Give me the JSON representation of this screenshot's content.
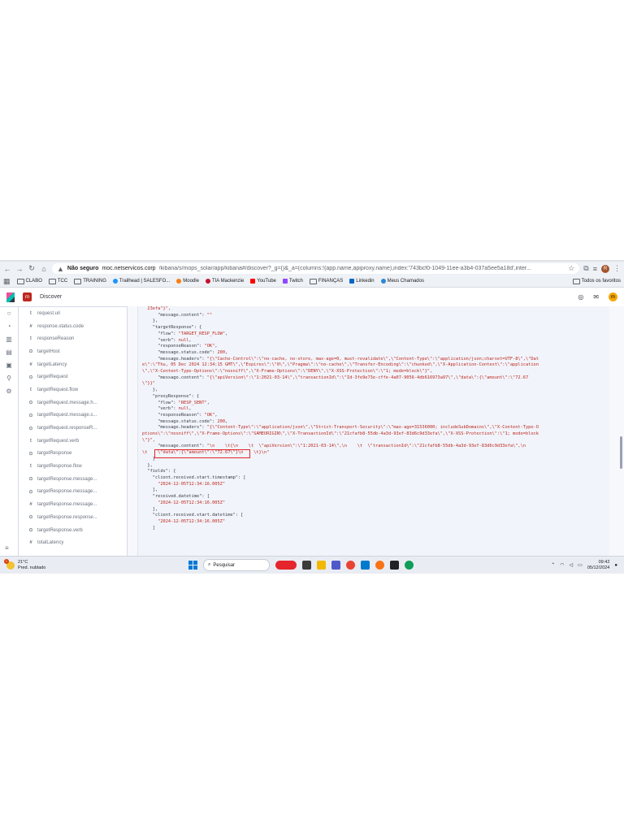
{
  "browser": {
    "security_label": "Não seguro",
    "url_domain": "moc.netservicos.corp",
    "url_path": "/kibana/s/mops_solar/app/kibana#/discover?_g=()&_a=(columns:!(app.name,apiproxy.name),index:'743bcf0-1049-11ee-a3b4-037a5ee5a18d',inter...",
    "profile_initial": "R",
    "bookmarks": [
      "CLABO",
      "TCC",
      "TRAINING",
      "Trailhead | SALESFO...",
      "Moodle",
      "TIA Mackenzie",
      "YouTube",
      "Twitch",
      "FINANÇAS",
      "Linkedin",
      "Meus Chamados"
    ],
    "all_bookmarks": "Todos os favoritos",
    "accent": "#1a73e8"
  },
  "kibana": {
    "space_initial": "m",
    "page_title": "Discover",
    "user_initial": "m"
  },
  "fields": [
    {
      "type": "t",
      "name": "request.uri"
    },
    {
      "type": "#",
      "name": "response.status.code"
    },
    {
      "type": "t",
      "name": "responseReason"
    },
    {
      "type": "⊙",
      "name": "targetHost"
    },
    {
      "type": "#",
      "name": "targetLatency"
    },
    {
      "type": "⊙",
      "name": "targetRequest"
    },
    {
      "type": "t",
      "name": "targetRequest.flow"
    },
    {
      "type": "⊙",
      "name": "targetRequest.message.h..."
    },
    {
      "type": "⊙",
      "name": "targetRequest.message.s..."
    },
    {
      "type": "⊙",
      "name": "targetRequest.responseR..."
    },
    {
      "type": "t",
      "name": "targetRequest.verb"
    },
    {
      "type": "⊙",
      "name": "targetResponse"
    },
    {
      "type": "t",
      "name": "targetResponse.flow"
    },
    {
      "type": "⊙",
      "name": "targetResponse.message..."
    },
    {
      "type": "⊙",
      "name": "targetResponse.message..."
    },
    {
      "type": "#",
      "name": "targetResponse.message..."
    },
    {
      "type": "⊙",
      "name": "targetResponse.response..."
    },
    {
      "type": "⊙",
      "name": "targetResponse.verb"
    },
    {
      "type": "#",
      "name": "totalLatency"
    }
  ],
  "json_lines": [
    [
      {
        "c": "s",
        "t": "  23efa\"}\","
      }
    ],
    [
      {
        "c": "k",
        "t": "      \"message.content\": "
      },
      {
        "c": "s",
        "t": "\"\""
      }
    ],
    [
      {
        "c": "k",
        "t": "    },"
      }
    ],
    [
      {
        "c": "k",
        "t": "    \"targetResponse\": {"
      }
    ],
    [
      {
        "c": "k",
        "t": "      \"flow\": "
      },
      {
        "c": "s",
        "t": "\"TARGET_RESP_FLOW\""
      },
      {
        "c": "k",
        "t": ","
      }
    ],
    [
      {
        "c": "k",
        "t": "      \"verb\": "
      },
      {
        "c": "s",
        "t": "null"
      },
      {
        "c": "k",
        "t": ","
      }
    ],
    [
      {
        "c": "k",
        "t": "      \"responseReason\": "
      },
      {
        "c": "s",
        "t": "\"OK\""
      },
      {
        "c": "k",
        "t": ","
      }
    ],
    [
      {
        "c": "k",
        "t": "      \"message.status.code\": "
      },
      {
        "c": "s",
        "t": "200"
      },
      {
        "c": "k",
        "t": ","
      }
    ],
    [
      {
        "c": "k",
        "t": "      \"message.headers\": "
      },
      {
        "c": "s",
        "t": "\"{\\\"Cache-Control\\\":\\\"no-cache, no-store, max-age=0, must-revalidate\\\",\\\"Content-Type\\\":\\\"application/json;charset=UTF-8\\\",\\\"Dat"
      }
    ],
    [
      {
        "c": "s",
        "t": "e\\\":\\\"Thu, 05 Dec 2024 12:34:15 GMT\\\",\\\"Expires\\\":\\\"0\\\",\\\"Pragma\\\":\\\"no-cache\\\",\\\"Transfer-Encoding\\\":\\\"chunked\\\",\\\"X-Application-Context\\\":\\\"application"
      }
    ],
    [
      {
        "c": "s",
        "t": "\\\",\\\"X-Content-Type-Options\\\":\\\"nosniff\\\",\\\"X-Frame-Options\\\":\\\"DENY\\\",\\\"X-XSS-Protection\\\":\\\"1; mode=block\\\"}\","
      }
    ],
    [
      {
        "c": "k",
        "t": "      \"message.content\": "
      },
      {
        "c": "s",
        "t": "\"{\\\"apiVersion\\\":\\\"1:2021-03-14\\\",\\\"transactionId\\\":\\\"Id-3fe9e73e-cffe-4a07-9056-4db616973a97\\\",\\\"data\\\":{\\\"amount\\\":\\\"72.67"
      }
    ],
    [
      {
        "c": "s",
        "t": "\\\"}}\""
      }
    ],
    [
      {
        "c": "k",
        "t": "    },"
      }
    ],
    [
      {
        "c": "k",
        "t": "    \"proxyResponse\": {"
      }
    ],
    [
      {
        "c": "k",
        "t": "      \"flow\": "
      },
      {
        "c": "s",
        "t": "\"RESP_SENT\""
      },
      {
        "c": "k",
        "t": ","
      }
    ],
    [
      {
        "c": "k",
        "t": "      \"verb\": "
      },
      {
        "c": "s",
        "t": "null"
      },
      {
        "c": "k",
        "t": ","
      }
    ],
    [
      {
        "c": "k",
        "t": "      \"responseReason\": "
      },
      {
        "c": "s",
        "t": "\"OK\""
      },
      {
        "c": "k",
        "t": ","
      }
    ],
    [
      {
        "c": "k",
        "t": "      \"message.status.code\": "
      },
      {
        "c": "s",
        "t": "200"
      },
      {
        "c": "k",
        "t": ","
      }
    ],
    [
      {
        "c": "k",
        "t": "      \"message.headers\": "
      },
      {
        "c": "s",
        "t": "\"{\\\"Content-Type\\\":\\\"application/json\\\",\\\"Strict-Transport-Security\\\":\\\"max-age=31536000; includeSubDomains\\\",\\\"X-Content-Type-O"
      }
    ],
    [
      {
        "c": "s",
        "t": "ptions\\\":\\\"nosniff\\\",\\\"X-Frame-Options\\\":\\\"SAMEORIGIN\\\",\\\"X-TransactionId\\\":\\\"21cfafb8-55db-4a3d-93ef-83d6c9d33efa\\\",\\\"X-XSS-Protection\\\":\\\"1; mode=block"
      }
    ],
    [
      {
        "c": "s",
        "t": "\\\"}\","
      }
    ],
    [
      {
        "c": "k",
        "t": "      \"message.content\": "
      },
      {
        "c": "s",
        "t": "\"\\n    \\t{\\n    \\t  \\\"apiVersion\\\":\\\"1:2021-03-14\\\",\\n    \\t  \\\"transactionId\\\":\\\"21cfafb8-55db-4a3d-93ef-83d6c9d33efa\\\",\\n"
      }
    ],
    [
      {
        "c": "s",
        "t": "\\t    \\\"data\\\":{\\\"amount\\\":\\\"72.67\\\"}\\n    \\t}\\n\""
      }
    ],
    [
      {
        "c": "k",
        "t": "    }"
      }
    ],
    [
      {
        "c": "k",
        "t": "  },"
      }
    ],
    [
      {
        "c": "k",
        "t": "  \"fields\": {"
      }
    ],
    [
      {
        "c": "k",
        "t": "    \"client.received.start.timestamp\": ["
      }
    ],
    [
      {
        "c": "s",
        "t": "      \"2024-12-05T12:34:16.005Z\""
      }
    ],
    [
      {
        "c": "k",
        "t": "    ],"
      }
    ],
    [
      {
        "c": "k",
        "t": "    \"received.datetime\": ["
      }
    ],
    [
      {
        "c": "s",
        "t": "      \"2024-12-05T12:34:16.005Z\""
      }
    ],
    [
      {
        "c": "k",
        "t": "    ],"
      }
    ],
    [
      {
        "c": "k",
        "t": "    \"client.received.start.datetime\": ["
      }
    ],
    [
      {
        "c": "s",
        "t": "      \"2024-12-05T12:34:16.005Z\""
      }
    ],
    [
      {
        "c": "k",
        "t": "    ]"
      }
    ]
  ],
  "taskbar": {
    "temperature": "21°C",
    "weather": "Pred. nublado",
    "search_placeholder": "Pesquisar",
    "time": "09:42",
    "date": "05/12/2024"
  }
}
